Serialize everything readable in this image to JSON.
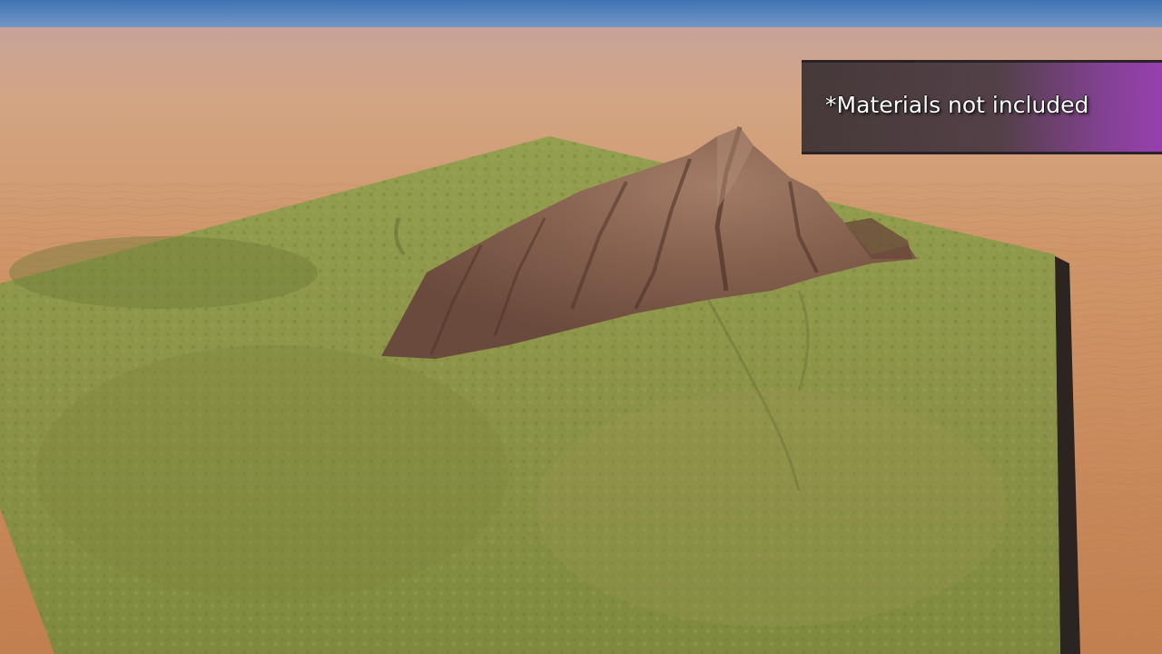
{
  "scene": {
    "description_tag": "",
    "colors": {
      "sky_top": "#4d7fb8",
      "horizon_haze": "#b69a9a",
      "sand": "#c88d5f",
      "sand_far": "#d1a07f",
      "grass_light": "#8e9a48",
      "grass_dark": "#6f7a3a",
      "rock": "#8a6552",
      "rock_dark": "#5a3e34",
      "banner_dark": "#3a3032",
      "banner_purple": "#9a3caf"
    }
  },
  "caption": {
    "text": "*Materials not included"
  }
}
